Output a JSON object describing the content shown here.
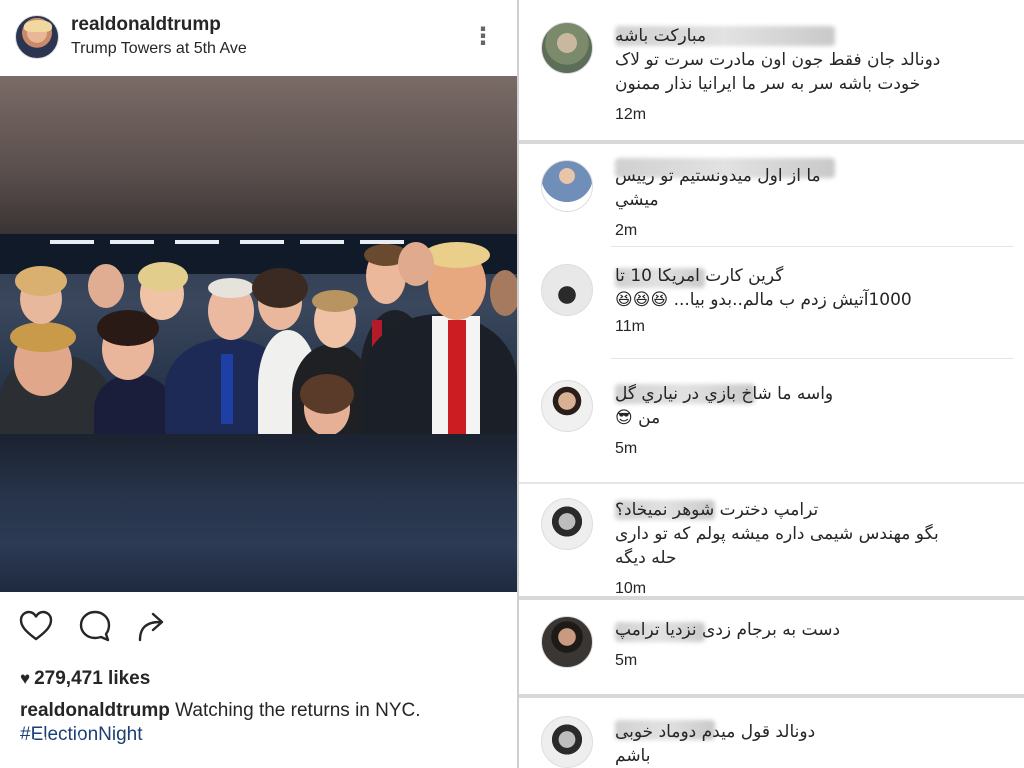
{
  "post": {
    "username": "realdonaldtrump",
    "location": "Trump Towers at 5th Ave",
    "more_icon": "⋮",
    "likes": "279,471 likes",
    "likes_heart": "♥",
    "caption_user": "realdonaldtrump",
    "caption_text": " Watching the returns in NYC.",
    "hashtag": "#ElectionNight"
  },
  "comments": [
    {
      "text": "مبارکت باشه\nدونالد جان فقط جون اون مادرت سرت تو لاک\nخودت باشه سر به سر ما ایرانیا نذار ممنون",
      "time": "12m"
    },
    {
      "text": "ما از اول میدونستیم تو رییس\nميشي",
      "time": "2m"
    },
    {
      "text": "گرین کارت امریکا 10 تا\n1000آتیش زدم ب مالم..بدو بیا... 😆😆😆",
      "time": "11m"
    },
    {
      "text": "واسه ما شاخ بازي در نياري گل\nمن 😎",
      "time": "5m"
    },
    {
      "text": "ترامپ دخترت شوهر نمیخاد؟\nبگو مهندس شیمی داره میشه پولم که تو داری\nحله دیگه",
      "time": "10m"
    },
    {
      "text": "دست به برجام زدی نزدیا ترامپ",
      "time": "5m"
    },
    {
      "text": "دونالد قول میدم دوماد خوبی\nباشم",
      "time": ""
    }
  ],
  "colors": {
    "text": "#262626",
    "hashtag": "#1a3f75",
    "divider": "#cfcfcf"
  }
}
